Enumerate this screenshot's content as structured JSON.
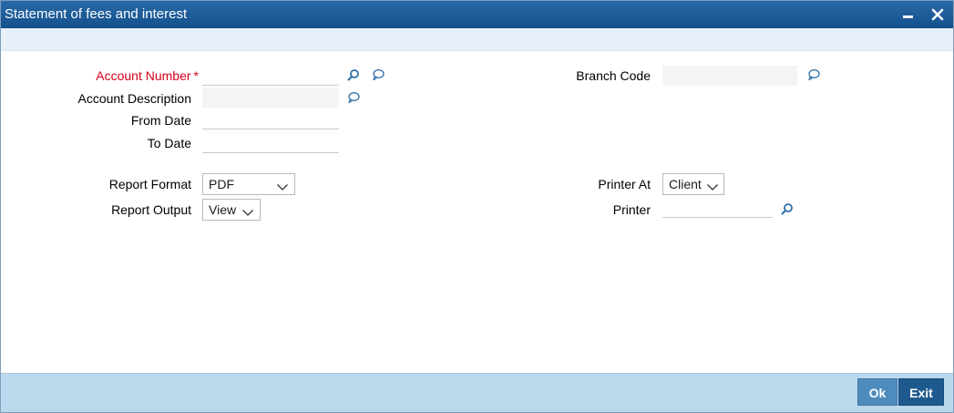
{
  "window": {
    "title": "Statement of fees and interest",
    "minimize_icon": "minimize-icon",
    "close_icon": "close-icon"
  },
  "form": {
    "account_number": {
      "label": "Account Number",
      "required_marker": "*",
      "value": ""
    },
    "account_description": {
      "label": "Account Description",
      "value": ""
    },
    "from_date": {
      "label": "From Date",
      "value": ""
    },
    "to_date": {
      "label": "To Date",
      "value": ""
    },
    "branch_code": {
      "label": "Branch Code",
      "value": ""
    },
    "report_format": {
      "label": "Report Format",
      "selected": "PDF"
    },
    "report_output": {
      "label": "Report Output",
      "selected": "View"
    },
    "printer_at": {
      "label": "Printer At",
      "selected": "Client"
    },
    "printer": {
      "label": "Printer",
      "value": ""
    }
  },
  "icons": {
    "search": "search-icon",
    "comment": "comment-bubble-icon",
    "chevron": "chevron-down-icon"
  },
  "footer": {
    "ok_label": "Ok",
    "exit_label": "Exit"
  },
  "colors": {
    "titlebar": "#1c5a96",
    "required_label": "#d4001a",
    "footer_bg": "#bcd8ec",
    "ok_button": "#4e8cbd",
    "exit_button": "#1f5a8f",
    "icon_blue": "#2f6fa8"
  }
}
